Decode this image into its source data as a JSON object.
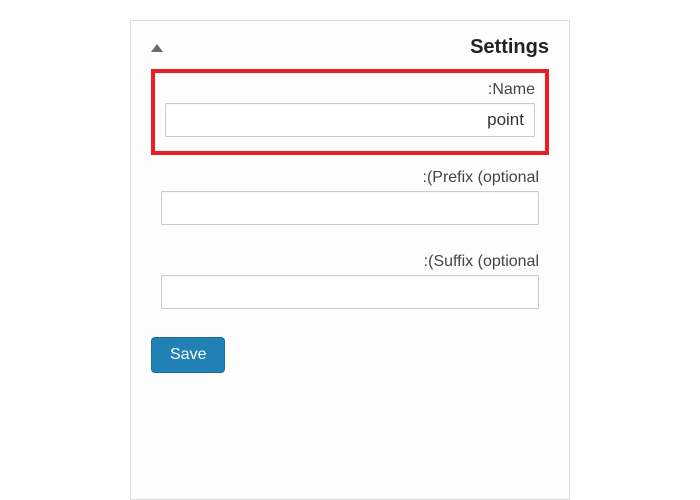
{
  "panel": {
    "title": "Settings"
  },
  "fields": {
    "name": {
      "label": ":Name",
      "value": "point",
      "highlighted": true
    },
    "prefix": {
      "label": ":(Prefix (optional",
      "value": ""
    },
    "suffix": {
      "label": ":(Suffix (optional",
      "value": ""
    }
  },
  "actions": {
    "save_label": "Save"
  },
  "colors": {
    "highlight_border": "#ed1c24",
    "primary_button": "#2181b5"
  }
}
